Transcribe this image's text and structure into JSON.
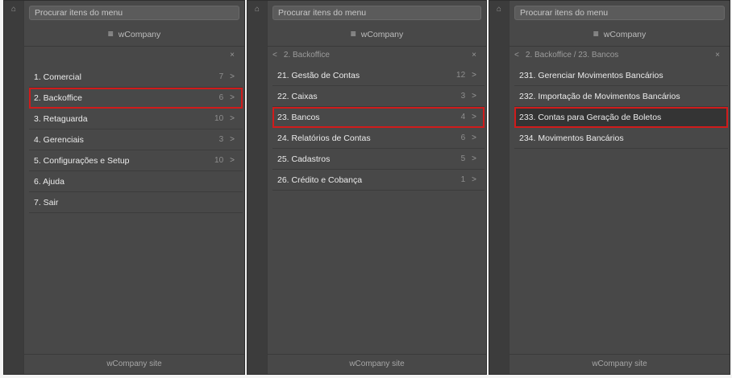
{
  "common": {
    "search_placeholder": "Procurar itens do menu",
    "brand": "wCompany",
    "footer": "wCompany site",
    "close_glyph": "×",
    "back_glyph": "<",
    "chevron_glyph": ">",
    "home_glyph": "⌂",
    "hamburger_glyph": "≡",
    "highlight_color": "#d01b1b"
  },
  "panels": [
    {
      "header": "",
      "items": [
        {
          "label": "1. Comercial",
          "count": "7",
          "chev": true
        },
        {
          "label": "2. Backoffice",
          "count": "6",
          "chev": true,
          "highlight": true
        },
        {
          "label": "3. Retaguarda",
          "count": "10",
          "chev": true
        },
        {
          "label": "4. Gerenciais",
          "count": "3",
          "chev": true
        },
        {
          "label": "5. Configurações e Setup",
          "count": "10",
          "chev": true
        },
        {
          "label": "6. Ajuda",
          "count": "",
          "chev": false
        },
        {
          "label": "7. Sair",
          "count": "",
          "chev": false
        }
      ]
    },
    {
      "header": "2. Backoffice",
      "items": [
        {
          "label": "21. Gestão de Contas",
          "count": "12",
          "chev": true
        },
        {
          "label": "22. Caixas",
          "count": "3",
          "chev": true
        },
        {
          "label": "23. Bancos",
          "count": "4",
          "chev": true,
          "highlight": true
        },
        {
          "label": "24. Relatórios de Contas",
          "count": "6",
          "chev": true
        },
        {
          "label": "25. Cadastros",
          "count": "5",
          "chev": true
        },
        {
          "label": "26. Crédito e Cobança",
          "count": "1",
          "chev": true
        }
      ]
    },
    {
      "header": "2. Backoffice / 23. Bancos",
      "items": [
        {
          "label": "231. Gerenciar Movimentos Bancários",
          "count": "",
          "chev": false
        },
        {
          "label": "232. Importação de Movimentos Bancários",
          "count": "",
          "chev": false
        },
        {
          "label": "233. Contas para Geração de Boletos",
          "count": "",
          "chev": false,
          "highlight": true,
          "active": true
        },
        {
          "label": "234. Movimentos Bancários",
          "count": "",
          "chev": false
        }
      ]
    }
  ]
}
